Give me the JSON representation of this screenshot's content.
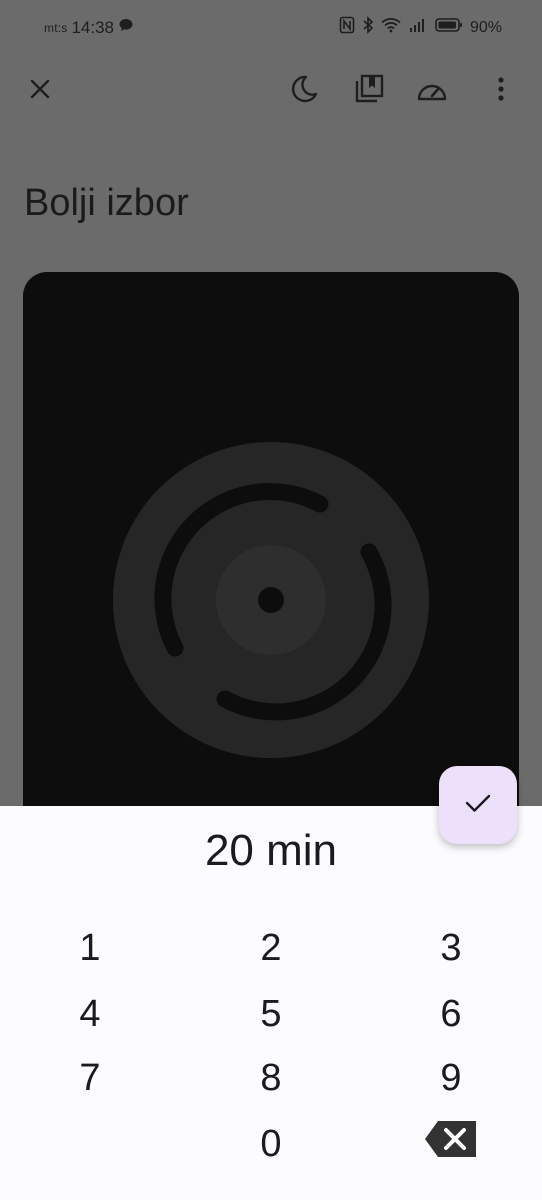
{
  "status_bar": {
    "carrier": "mt:s",
    "time": "14:38",
    "battery_percent": "90%",
    "icons": [
      "message-icon",
      "nfc-icon",
      "bluetooth-icon",
      "wifi-icon",
      "signal-icon",
      "battery-icon"
    ]
  },
  "toolbar": {
    "icons": [
      "close-icon",
      "sleep-timer-icon",
      "bookmarks-icon",
      "speed-icon",
      "more-vert-icon"
    ]
  },
  "page": {
    "title": "Bolji izbor"
  },
  "timer_sheet": {
    "value": "20 min",
    "keys": [
      "1",
      "2",
      "3",
      "4",
      "5",
      "6",
      "7",
      "8",
      "9",
      "0"
    ],
    "confirm_icon": "check-icon",
    "backspace_icon": "backspace-icon"
  },
  "colors": {
    "scrim": "#6b6b6b",
    "artwork_bg": "#0d0d0d",
    "sheet_bg": "#fcfbfe",
    "fab_bg": "#ede0fb"
  }
}
